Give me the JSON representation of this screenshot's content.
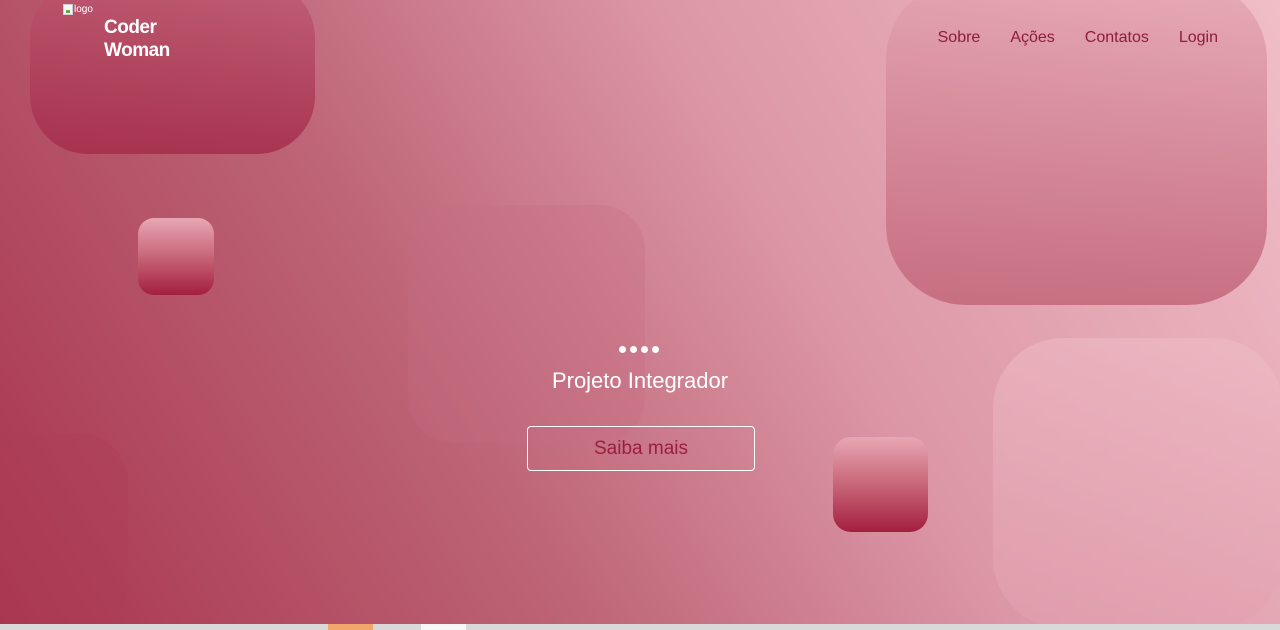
{
  "brand": {
    "logo_alt": "logo",
    "line1": "Coder",
    "line2": "Woman"
  },
  "nav": {
    "items": [
      {
        "label": "Sobre"
      },
      {
        "label": "Ações"
      },
      {
        "label": "Contatos"
      },
      {
        "label": "Login"
      }
    ]
  },
  "hero": {
    "slide_count": 4,
    "active_slide": 1,
    "title": "Projeto Integrador",
    "cta_label": "Saiba mais"
  },
  "colors": {
    "accent": "#8e1d37",
    "gradient_start": "#a8354f",
    "gradient_end": "#f0bec8",
    "text_light": "#ffffff"
  }
}
